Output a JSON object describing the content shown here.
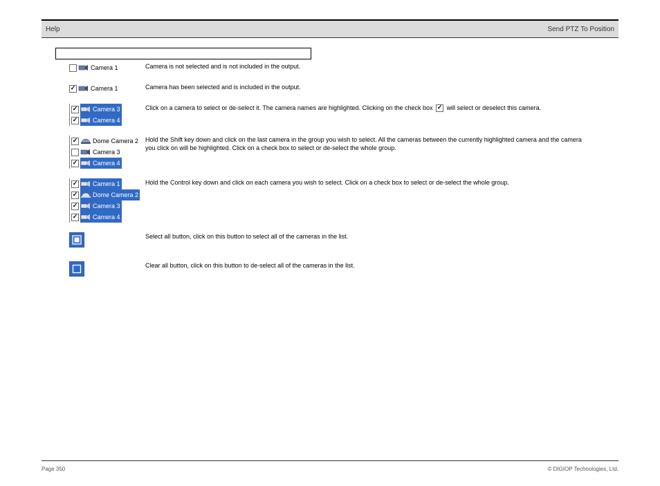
{
  "header": {
    "left": "Help",
    "right": "Send PTZ To Position"
  },
  "row1": {
    "label": "Camera 1",
    "desc": "Camera is not selected and is not included in the output."
  },
  "row2": {
    "label": "Camera 1",
    "desc": "Camera has been selected and is included in the output."
  },
  "row3": {
    "labels": {
      "a": "Camera 3",
      "b": "Camera 4"
    },
    "desc_pre": "Click on a camera to select or de-select it. The camera names are highlighted. Clicking on the check box ",
    "desc_post": " will select or deselect this camera."
  },
  "row4": {
    "labels": {
      "a": "Dome Camera 2",
      "b": "Camera 3",
      "c": "Camera 4"
    },
    "desc": "Hold the Shift key down and click on the last camera in the group you wish to select. All the cameras between the currently highlighted camera and the camera you click on will be highlighted. Click on a check box to select or de-select the whole group."
  },
  "row5": {
    "labels": {
      "a": "Camera 1",
      "b": "Dome Camera 2",
      "c": "Camera 3",
      "d": "Camera 4"
    },
    "desc": "Hold the Control key down and click on each camera you wish to select. Click on a check box to select or de-select the whole group."
  },
  "toolA": {
    "desc": "Select all button, click on this button to select all of the cameras in the list."
  },
  "toolB": {
    "desc": "Clear all button, click on this button to de-select all of the cameras in the list."
  },
  "footer": {
    "left": "Page 350",
    "right": "© DIGIOP Technologies, Ltd."
  }
}
